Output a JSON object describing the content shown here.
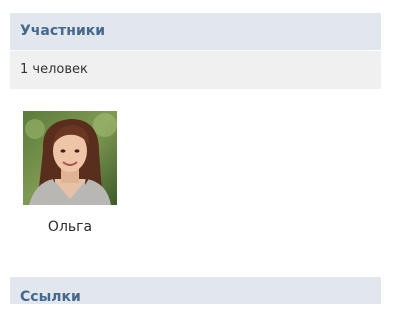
{
  "members_section": {
    "title": "Участники",
    "count_text": "1 человек",
    "members": [
      {
        "name": "Ольга"
      }
    ]
  },
  "links_section": {
    "title": "Ссылки"
  },
  "colors": {
    "header_bg": "#e1e7ed",
    "header_text": "#45688e",
    "count_bg": "#f0f0f0"
  }
}
